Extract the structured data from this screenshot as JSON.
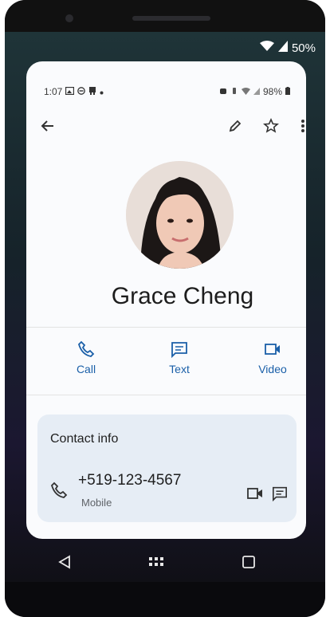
{
  "outer_status": {
    "battery": "50%"
  },
  "status_bar": {
    "time": "1:07",
    "battery": "98%"
  },
  "contact": {
    "name": "Grace Cheng"
  },
  "actions": [
    {
      "label": "Call",
      "icon": "phone-icon"
    },
    {
      "label": "Text",
      "icon": "message-icon"
    },
    {
      "label": "Video",
      "icon": "video-icon"
    }
  ],
  "contact_info": {
    "title": "Contact info",
    "phone": "+519-123-4567",
    "phone_type": "Mobile"
  },
  "toolbar_icons": [
    "back-arrow-icon",
    "edit-pencil-icon",
    "star-icon",
    "more-vert-icon"
  ],
  "nav_icons": [
    "back-triangle-icon",
    "app-drawer-icon",
    "recents-square-icon"
  ],
  "colors": {
    "accent": "#1a5fa8",
    "card_bg": "#e6edf5",
    "screen_bg": "#fafbfd"
  }
}
